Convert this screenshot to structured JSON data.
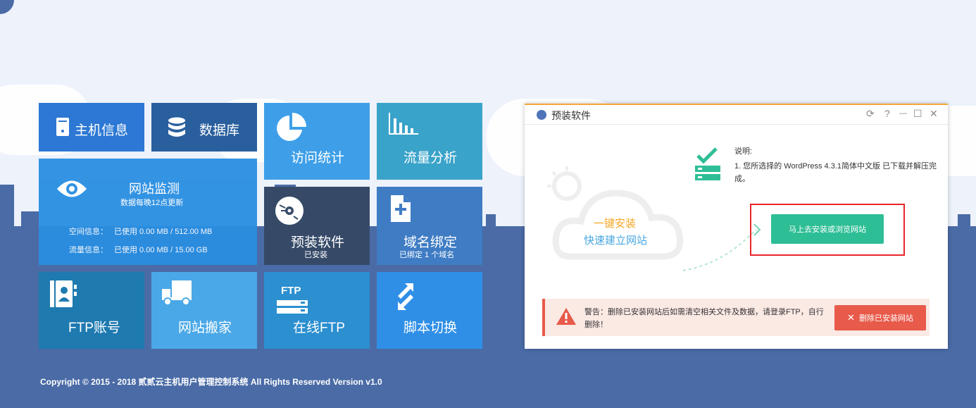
{
  "tiles": {
    "host_info": {
      "label": "主机信息",
      "icon": "server-icon",
      "color": "#2c78d4"
    },
    "database": {
      "label": "数据库",
      "icon": "database-icon",
      "color": "#2a5f9e"
    },
    "visit_stats": {
      "label": "访问统计",
      "icon": "pie-chart-icon",
      "color": "#3e9fe8"
    },
    "traffic": {
      "label": "流量分析",
      "icon": "bar-chart-icon",
      "color": "#3aa3c9"
    },
    "monitor": {
      "label": "网站监测",
      "sub": "数据每晚12点更新",
      "space_label": "空间信息：",
      "space_value": "已使用 0.00 MB / 512.00 MB",
      "flow_label": "流量信息：",
      "flow_value": "已使用 0.00 MB / 15.00 GB",
      "icon": "eye-icon",
      "color": "#2a8ee2"
    },
    "preinstall": {
      "label": "预装软件",
      "sub": "已安装",
      "icon": "disc-icon",
      "color": "#364a68"
    },
    "domain": {
      "label": "域名绑定",
      "sub": "已绑定 1 个域名",
      "icon": "document-add-icon",
      "color": "#3f7cc4"
    },
    "ftp_account": {
      "label": "FTP账号",
      "icon": "contacts-icon",
      "color": "#1f7ab0"
    },
    "move_site": {
      "label": "网站搬家",
      "icon": "truck-icon",
      "color": "#4aa8e8"
    },
    "online_ftp": {
      "label": "在线FTP",
      "icon_text": "FTP",
      "icon": "ftp-server-icon",
      "color": "#2b8fd0"
    },
    "script_switch": {
      "label": "脚本切换",
      "icon": "switch-icon",
      "color": "#2f8fe6"
    }
  },
  "panel": {
    "title": "预装软件",
    "controls": [
      "⟳",
      "?",
      "—",
      "☐",
      "✕"
    ],
    "note_title": "说明:",
    "note_text": "1. 您所选择的 WordPress 4.3.1简体中文版 已下载并解压完成。",
    "cloud_line1": "一键安装",
    "cloud_line2": "快速建立网站",
    "install_button": "马上去安装或浏览网站",
    "warning_text": "警告：删除已安装网站后如需清空相关文件及数据，请登录FTP，自行删除！",
    "delete_button": "删除已安装网站",
    "accent": "#f7a534"
  },
  "footer": "Copyright © 2015 - 2018 贰贰云主机用户管理控制系统 All Rights Reserved Version v1.0"
}
